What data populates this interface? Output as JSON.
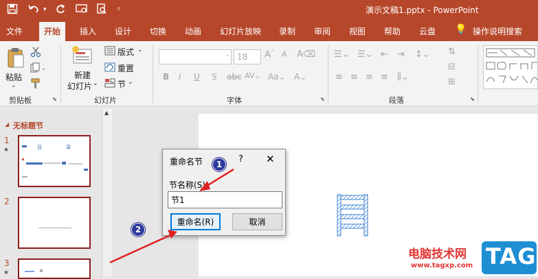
{
  "titlebar": {
    "document_title": "演示文稿1.pptx  -  PowerPoint",
    "icons": [
      "save-icon",
      "undo-icon",
      "redo-icon",
      "present-icon",
      "preview-icon",
      "customize-icon"
    ]
  },
  "tabs": [
    "文件",
    "开始",
    "插入",
    "设计",
    "切换",
    "动画",
    "幻灯片放映",
    "录制",
    "审阅",
    "视图",
    "帮助",
    "云盘",
    "操作说明搜索"
  ],
  "active_tab": "开始",
  "ribbon": {
    "paste_label": "粘贴",
    "clipboard_group": "剪贴板",
    "new_slide_label": "新建",
    "new_slide_label2": "幻灯片",
    "layout_label": "版式",
    "reset_label": "重置",
    "section_label": "节",
    "slides_group": "幻灯片",
    "font_size_value": "18",
    "font_group": "字体",
    "paragraph_group": "段落"
  },
  "left_pane": {
    "section_title": "无标题节",
    "slide_numbers": [
      "1",
      "2",
      "3"
    ],
    "slide1_texts": [
      "目",
      "录"
    ]
  },
  "dialog": {
    "title": "重命名节",
    "help": "?",
    "close": "✕",
    "field_label": "节名称(S):",
    "input_value": "节1",
    "rename_button": "重命名(R)",
    "cancel_button": "取消"
  },
  "annotations": {
    "badge1": "1",
    "badge2": "2"
  },
  "watermark": {
    "site_name": "电脑技术网",
    "url": "www.tagxp.com",
    "logo": "TAG"
  },
  "colors": {
    "accent": "#b7472a",
    "arrow": "#e02020",
    "badge": "#2d3a9c",
    "thumb_border": "#8b1f1f"
  }
}
